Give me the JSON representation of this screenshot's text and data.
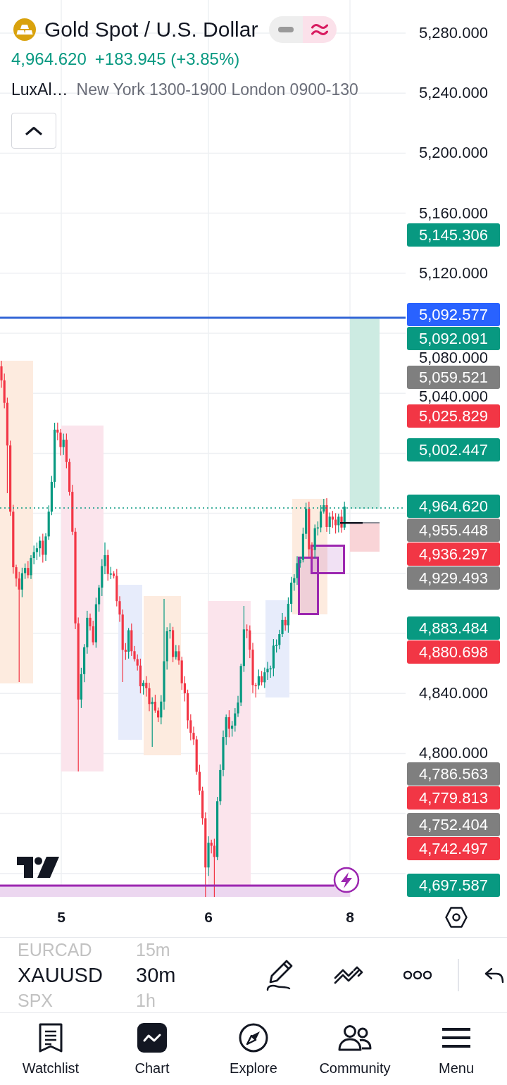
{
  "header": {
    "title": "Gold Spot / U.S. Dollar",
    "price": "4,964.620",
    "change": "+183.945 (+3.85%)",
    "toggles": [
      {
        "kind": "minus",
        "selected": false
      },
      {
        "kind": "approx",
        "selected": true
      }
    ]
  },
  "indicator": {
    "name": "LuxAl…",
    "settings": "New York 1300-1900 London 0900-130"
  },
  "price_axis": {
    "ticks": [
      "5,280.000",
      "5,240.000",
      "5,200.000",
      "5,160.000",
      "5,120.000",
      "5,080.000",
      "5,040.000",
      "4,840.000",
      "4,800.000"
    ],
    "tags": [
      {
        "price": "5,145.306",
        "color": "#089981"
      },
      {
        "price": "5,092.577",
        "color": "#2962ff"
      },
      {
        "price": "5,092.091",
        "color": "#089981"
      },
      {
        "price": "5,059.521",
        "color": "#7f7f7f"
      },
      {
        "price": "5,025.829",
        "color": "#f23645"
      },
      {
        "price": "5,002.447",
        "color": "#089981"
      },
      {
        "price": "4,964.620",
        "color": "#089981"
      },
      {
        "price": "4,955.448",
        "color": "#7f7f7f"
      },
      {
        "price": "4,936.297",
        "color": "#f23645"
      },
      {
        "price": "4,929.493",
        "color": "#7f7f7f"
      },
      {
        "price": "4,883.484",
        "color": "#089981"
      },
      {
        "price": "4,880.698",
        "color": "#f23645"
      },
      {
        "price": "4,786.563",
        "color": "#7f7f7f"
      },
      {
        "price": "4,779.813",
        "color": "#f23645"
      },
      {
        "price": "4,752.404",
        "color": "#7f7f7f"
      },
      {
        "price": "4,742.497",
        "color": "#f23645"
      },
      {
        "price": "4,697.587",
        "color": "#089981"
      }
    ]
  },
  "time_axis": {
    "labels": [
      "5",
      "6",
      "8"
    ]
  },
  "picker": {
    "symbols": [
      {
        "label": "EURCAD",
        "selected": false
      },
      {
        "label": "XAUUSD",
        "selected": true
      },
      {
        "label": "SPX",
        "selected": false
      }
    ],
    "intervals": [
      {
        "label": "15m",
        "selected": false
      },
      {
        "label": "30m",
        "selected": true
      },
      {
        "label": "1h",
        "selected": false
      }
    ]
  },
  "nav": [
    {
      "kind": "watchlist",
      "label": "Watchlist",
      "selected": false
    },
    {
      "kind": "chart",
      "label": "Chart",
      "selected": true
    },
    {
      "kind": "explore",
      "label": "Explore",
      "selected": false
    },
    {
      "kind": "community",
      "label": "Community",
      "selected": false
    },
    {
      "kind": "menu",
      "label": "Menu",
      "selected": false
    }
  ]
}
